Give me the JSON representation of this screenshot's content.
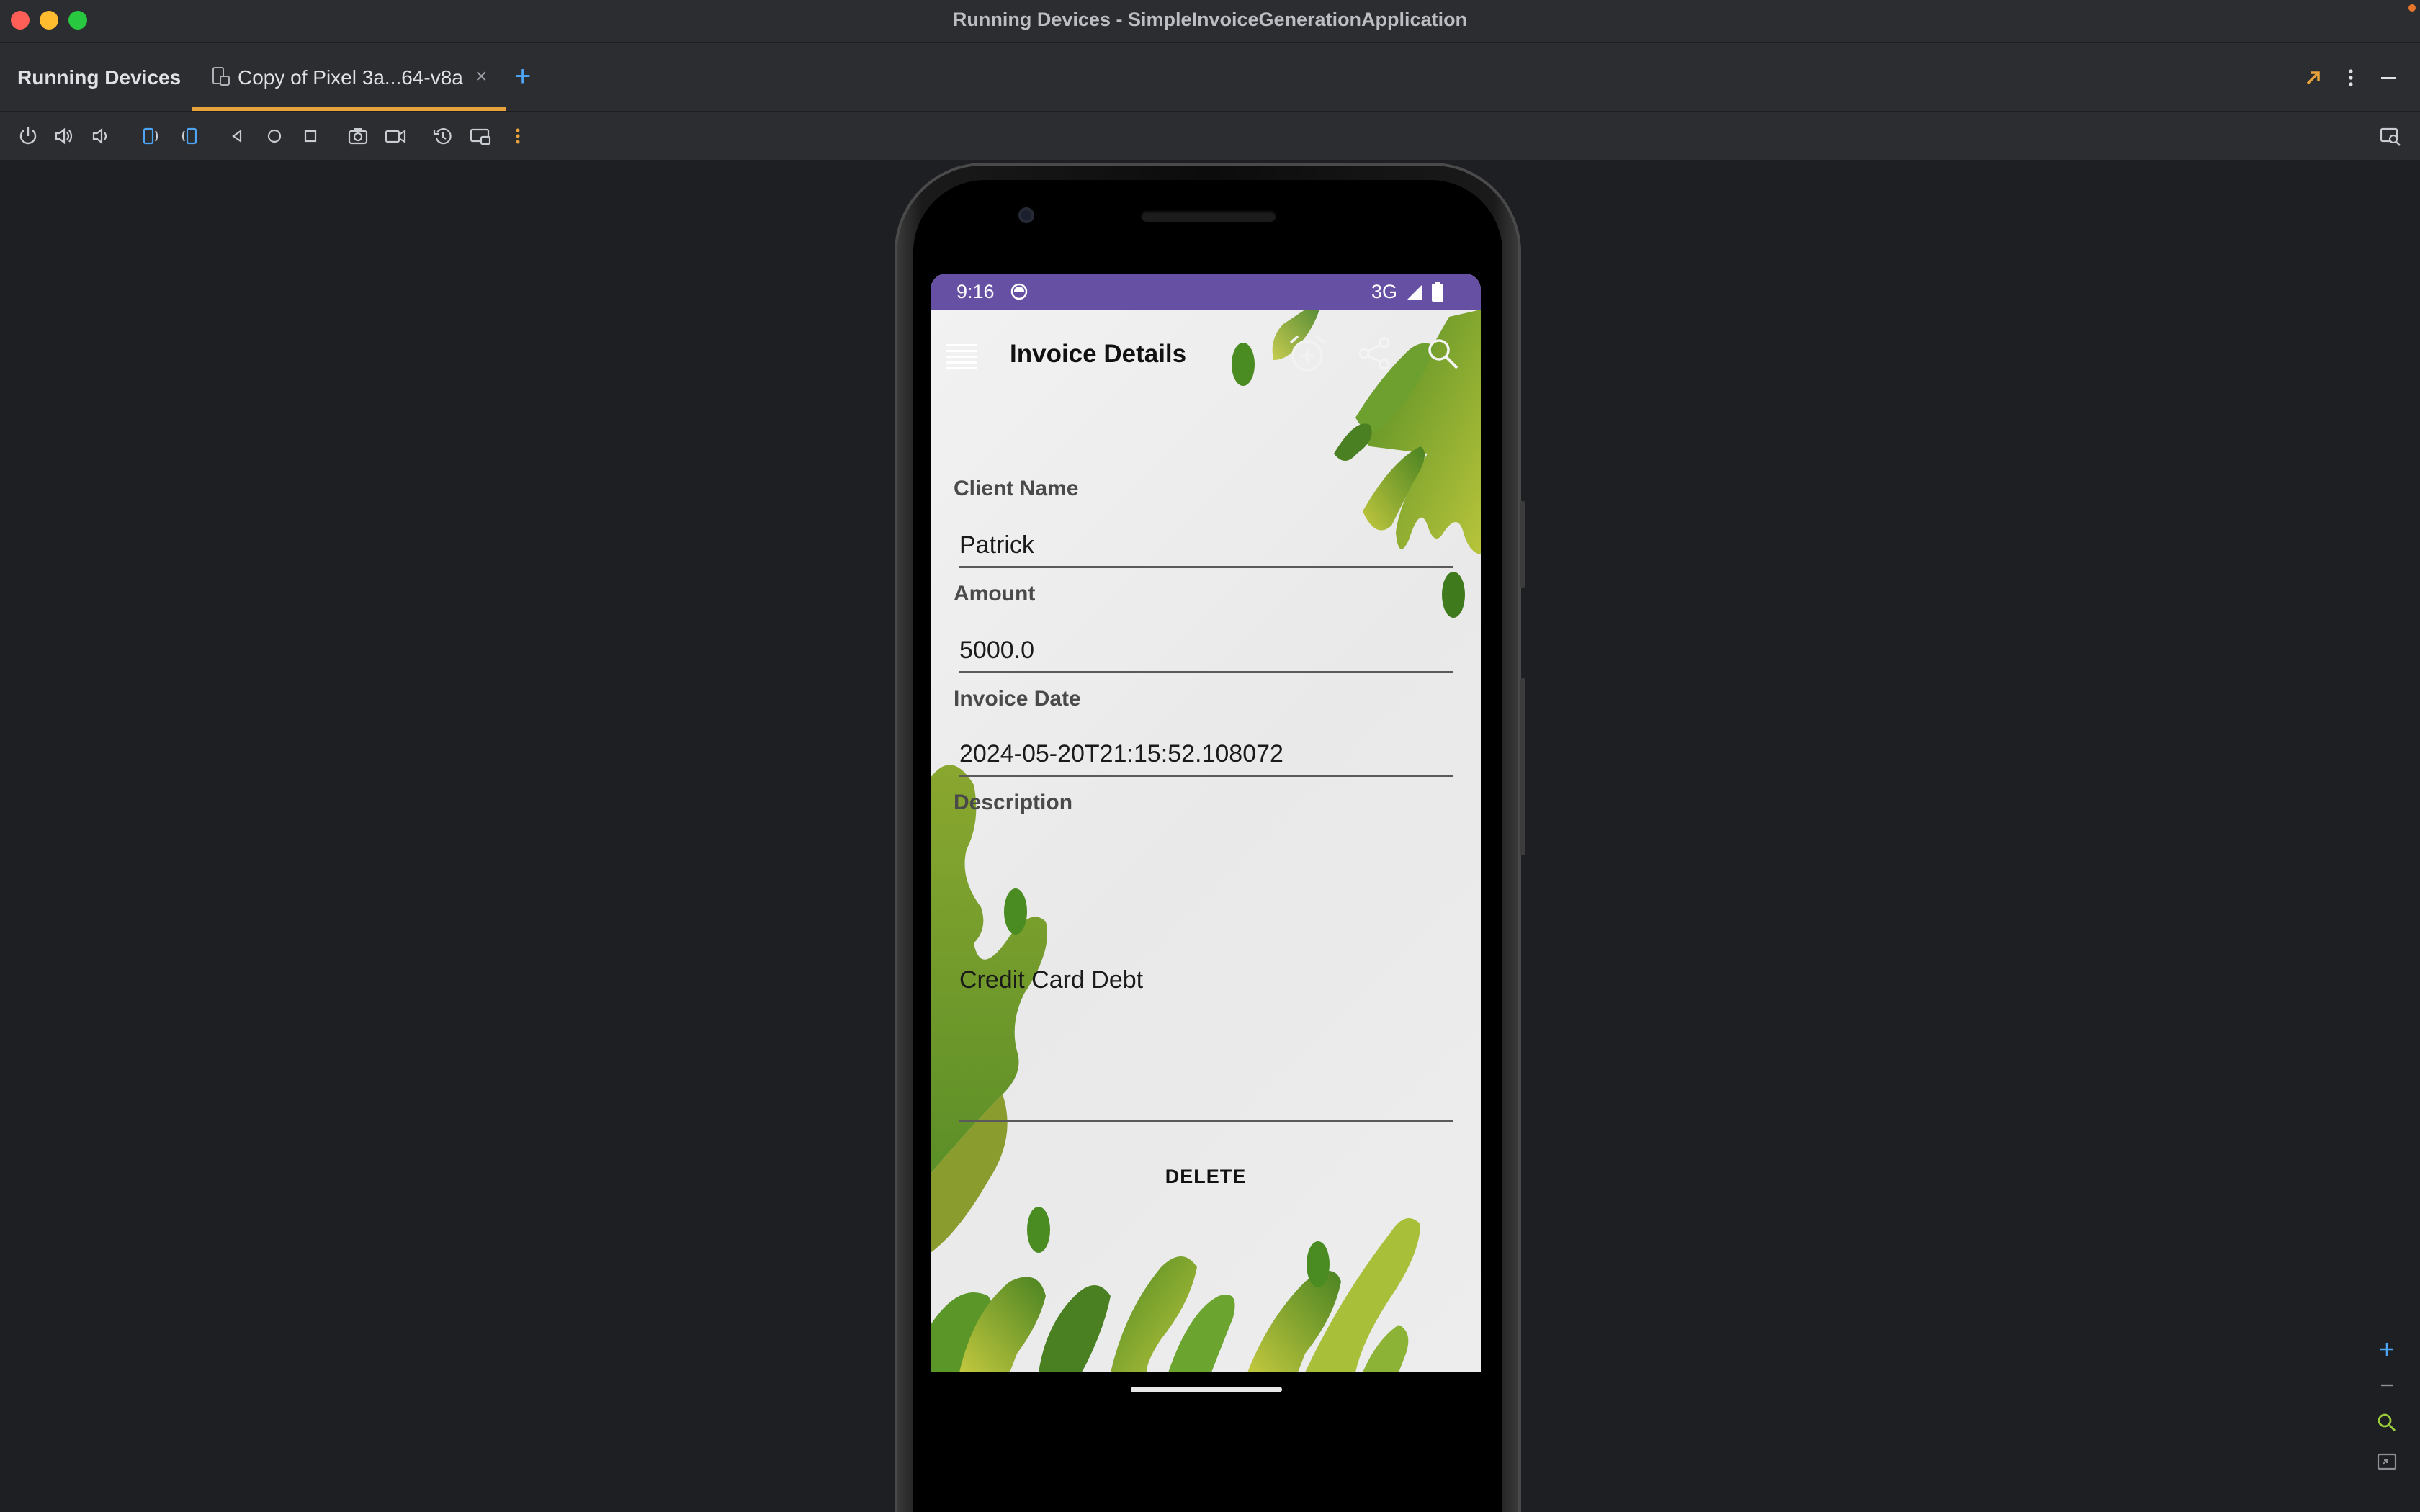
{
  "window": {
    "title": "Running Devices - SimpleInvoiceGenerationApplication"
  },
  "tabbar": {
    "tool_title": "Running Devices",
    "tab_label": "Copy of Pixel 3a...64-v8a",
    "close_glyph": "×",
    "add_glyph": "+",
    "icons": [
      "external-link-icon",
      "more-vert-icon",
      "minimize-icon"
    ]
  },
  "toolbar": {
    "icons": [
      "power-icon",
      "volume-up-icon",
      "volume-down-icon",
      "rotate-left-icon",
      "rotate-right-icon",
      "back-icon",
      "home-icon",
      "overview-icon",
      "screenshot-icon",
      "screen-record-icon",
      "reset-icon",
      "snapshot-icon",
      "more-vert-icon",
      "device-explorer-icon"
    ]
  },
  "device": {
    "status_bar": {
      "time": "9:16",
      "network": "3G"
    },
    "app_bar": {
      "title": "Invoice Details"
    },
    "form": {
      "client_name_label": "Client Name",
      "client_name_value": "Patrick",
      "amount_label": "Amount",
      "amount_value": "5000.0",
      "invoice_date_label": "Invoice Date",
      "invoice_date_value": "2024-05-20T21:15:52.108072",
      "description_label": "Description",
      "description_value": "Credit Card Debt"
    },
    "delete_label": "DELETE"
  },
  "zoom_controls": {
    "zoom_in": "+",
    "zoom_out": "−",
    "icons": [
      "zoom-in-icon",
      "zoom-out-icon",
      "zoom-actual-icon",
      "zoom-fit-icon"
    ]
  },
  "colors": {
    "status_bar": "#6650a4",
    "tab_underline": "#e8a33d",
    "accent_blue": "#4ea5f5",
    "leaf_green": "#5f9a2a",
    "leaf_lime": "#b6c33a"
  }
}
